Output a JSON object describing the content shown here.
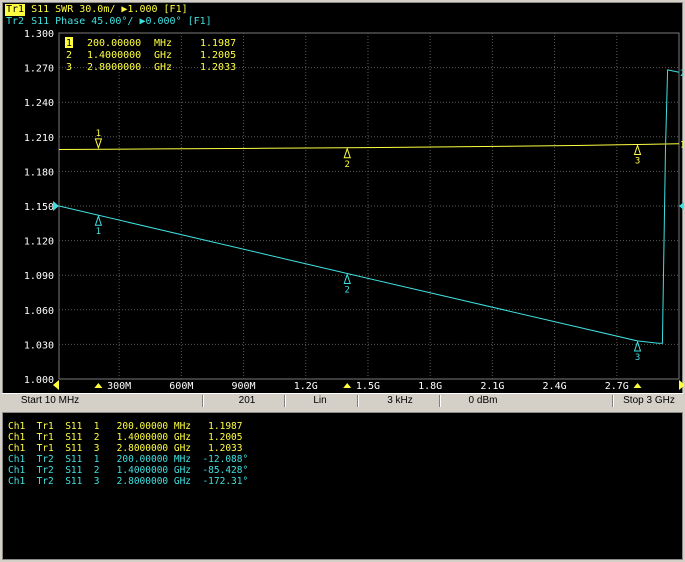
{
  "colors": {
    "trace1": "#ffff40",
    "trace2": "#40e0e0",
    "grid": "#5a5a5a",
    "background": "#000000",
    "axis_text": "#ffffff"
  },
  "header": {
    "tr1": {
      "tag": "Tr1",
      "text": " S11  SWR 30.0m/ ▶1.000  [F1]"
    },
    "tr2": {
      "tag": "Tr2",
      "text": " S11  Phase 45.00°/ ▶0.000° [F1]"
    }
  },
  "marker_legend": [
    {
      "num": "1",
      "freq": "200.00000",
      "unit": "MHz",
      "value": "1.1987"
    },
    {
      "num": "2",
      "freq": "1.4000000",
      "unit": "GHz",
      "value": "1.2005"
    },
    {
      "num": "3",
      "freq": "2.8000000",
      "unit": "GHz",
      "value": "1.2033"
    }
  ],
  "status": {
    "start": "Start 10 MHz",
    "points": "201",
    "sweep": "Lin",
    "ifbw": "3 kHz",
    "power": "0 dBm",
    "stop": "Stop 3 GHz"
  },
  "chart_data": {
    "type": "line",
    "xlim": [
      0.01,
      3.0
    ],
    "x_unit": "GHz",
    "ylim": [
      1.0,
      1.3
    ],
    "y_ticks": [
      "1.300",
      "1.270",
      "1.240",
      "1.210",
      "1.180",
      "1.150",
      "1.120",
      "1.090",
      "1.060",
      "1.030",
      "1.000"
    ],
    "x_ticks": [
      {
        "x": 0.3,
        "label": "300M"
      },
      {
        "x": 0.6,
        "label": "600M"
      },
      {
        "x": 0.9,
        "label": "900M"
      },
      {
        "x": 1.2,
        "label": "1.2G"
      },
      {
        "x": 1.5,
        "label": "1.5G"
      },
      {
        "x": 1.8,
        "label": "1.8G"
      },
      {
        "x": 2.1,
        "label": "2.1G"
      },
      {
        "x": 2.4,
        "label": "2.4G"
      },
      {
        "x": 2.7,
        "label": "2.7G"
      }
    ],
    "grid": true,
    "series": [
      {
        "name": "Tr1",
        "color": "#ffff40",
        "points": [
          [
            0.01,
            1.199
          ],
          [
            0.5,
            1.1995
          ],
          [
            1.0,
            1.2
          ],
          [
            1.4,
            1.2005
          ],
          [
            2.0,
            1.2015
          ],
          [
            2.5,
            1.2025
          ],
          [
            2.8,
            1.2033
          ],
          [
            3.0,
            1.204
          ]
        ],
        "end_label": "1",
        "markers": [
          {
            "num": "1",
            "x": 0.2,
            "y": 1.1987,
            "pos": "above"
          },
          {
            "num": "2",
            "x": 1.4,
            "y": 1.2005,
            "pos": "below"
          },
          {
            "num": "3",
            "x": 2.8,
            "y": 1.2033,
            "pos": "below"
          }
        ]
      },
      {
        "name": "Tr2",
        "color": "#40e0e0",
        "points": [
          [
            0.01,
            1.15
          ],
          [
            1.4,
            1.0915
          ],
          [
            2.8,
            1.033
          ],
          [
            2.9,
            1.031
          ],
          [
            2.92,
            1.031
          ],
          [
            2.935,
            1.2
          ],
          [
            2.945,
            1.268
          ],
          [
            3.0,
            1.266
          ]
        ],
        "end_label": "2",
        "markers": [
          {
            "num": "1",
            "x": 0.2,
            "y": 1.142,
            "pos": "below"
          },
          {
            "num": "2",
            "x": 1.4,
            "y": 1.0915,
            "pos": "below"
          },
          {
            "num": "3",
            "x": 2.8,
            "y": 1.033,
            "pos": "below"
          }
        ]
      }
    ],
    "ref_level_y": 1.15
  },
  "table": [
    {
      "text": "Ch1  Tr1  S11  1   200.00000 MHz   1.1987",
      "color": "#ffff40"
    },
    {
      "text": "Ch1  Tr1  S11  2   1.4000000 GHz   1.2005",
      "color": "#ffff40"
    },
    {
      "text": "Ch1  Tr1  S11  3   2.8000000 GHz   1.2033",
      "color": "#ffff40"
    },
    {
      "text": "Ch1  Tr2  S11  1   200.00000 MHz  -12.088°",
      "color": "#40e0e0"
    },
    {
      "text": "Ch1  Tr2  S11  2   1.4000000 GHz  -85.428°",
      "color": "#40e0e0"
    },
    {
      "text": "Ch1  Tr2  S11  3   2.8000000 GHz  -172.31°",
      "color": "#40e0e0"
    }
  ]
}
